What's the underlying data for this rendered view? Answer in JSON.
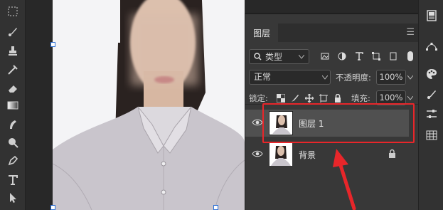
{
  "toolbar": {
    "tools": [
      "marquee-icon",
      "brush-icon",
      "stamp-icon",
      "history-brush-icon",
      "eraser-icon",
      "gradient-icon",
      "smudge-icon",
      "dodge-icon",
      "pen-icon",
      "type-icon",
      "select-arrow-icon"
    ]
  },
  "canvas": {
    "background": "#f6f6f8"
  },
  "layers_panel": {
    "tab_label": "图层",
    "filter": {
      "label": "类型",
      "icon": "search-icon"
    },
    "blend_mode": "正常",
    "opacity_label": "不透明度:",
    "opacity_value": "100%",
    "lock_label": "锁定:",
    "fill_label": "填充:",
    "fill_value": "100%",
    "layers": [
      {
        "name": "图层 1",
        "selected": true,
        "visible": true,
        "locked": false
      },
      {
        "name": "背景",
        "selected": false,
        "visible": true,
        "locked": true
      }
    ]
  },
  "right_strip": {
    "icons": [
      "properties-icon",
      "paths-icon",
      "color-palette-icon",
      "brush-settings-icon",
      "adjustments-icon",
      "grid-icon"
    ]
  },
  "annotation": {
    "highlight_color": "#e8262a"
  }
}
